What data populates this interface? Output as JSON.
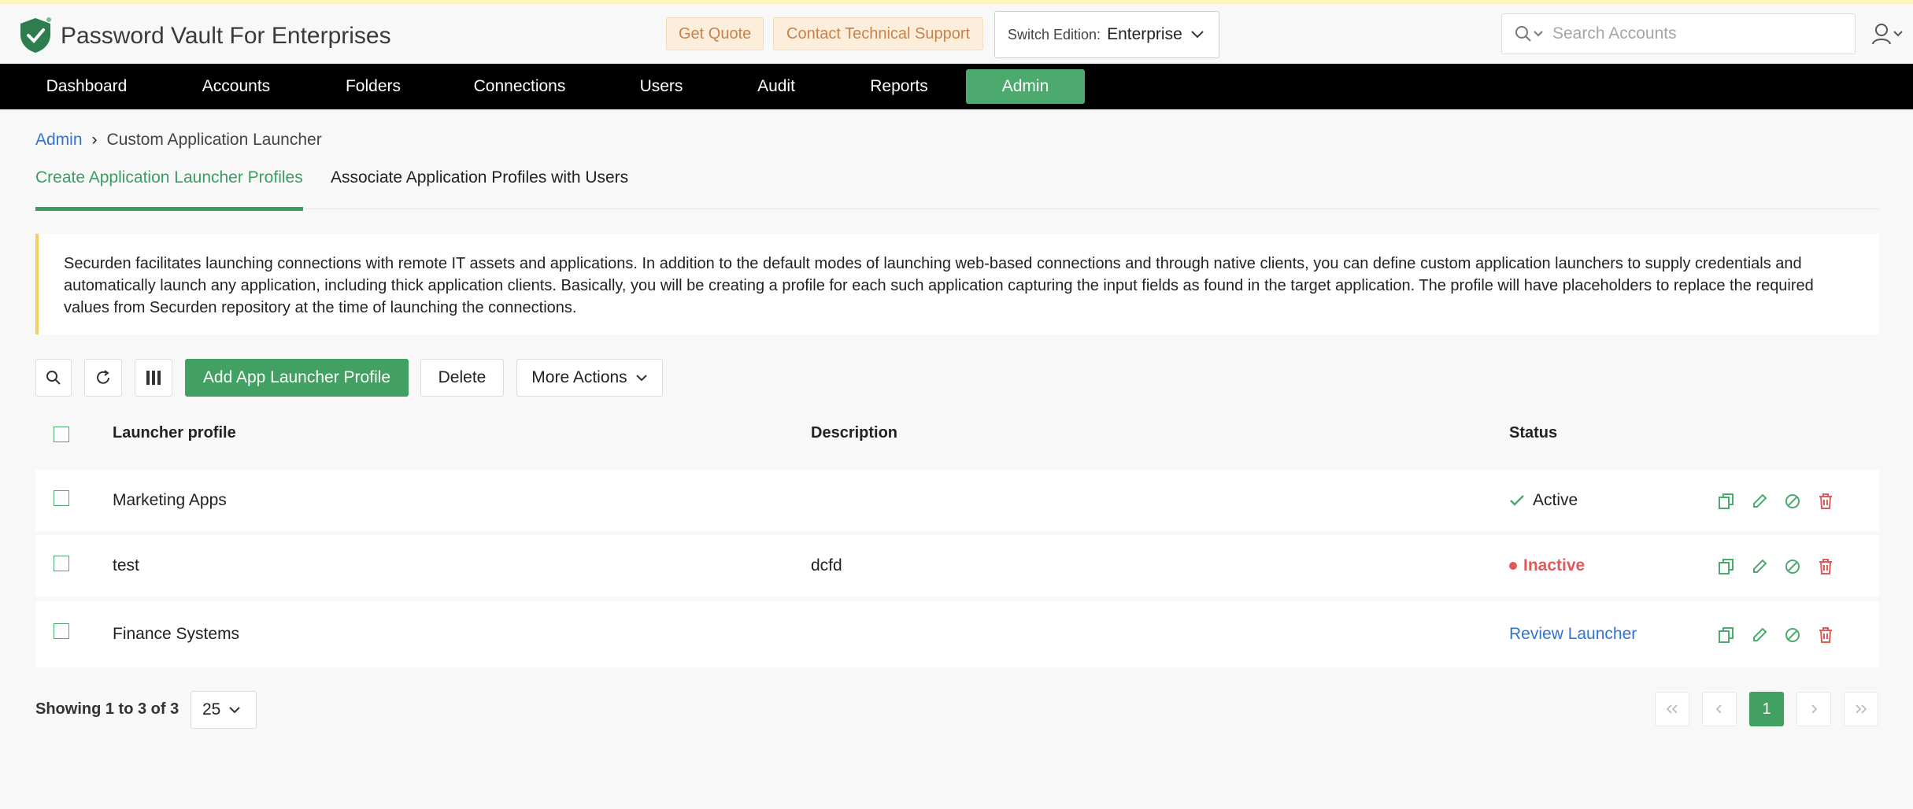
{
  "header": {
    "app_title": "Password Vault For Enterprises",
    "get_quote": "Get Quote",
    "contact_support": "Contact Technical Support",
    "edition_label": "Switch Edition:",
    "edition_value": "Enterprise",
    "search_placeholder": "Search Accounts"
  },
  "nav": {
    "items": [
      {
        "label": "Dashboard"
      },
      {
        "label": "Accounts"
      },
      {
        "label": "Folders"
      },
      {
        "label": "Connections"
      },
      {
        "label": "Users"
      },
      {
        "label": "Audit"
      },
      {
        "label": "Reports"
      },
      {
        "label": "Admin",
        "active": true
      }
    ]
  },
  "breadcrumb": {
    "root": "Admin",
    "separator": "›",
    "current": "Custom Application Launcher"
  },
  "tabs": [
    {
      "label": "Create Application Launcher Profiles",
      "active": true
    },
    {
      "label": "Associate Application Profiles with Users",
      "active": false
    }
  ],
  "notice": {
    "text": "Securden facilitates launching connections with remote IT assets and applications. In addition to the default modes of launching web-based connections and through native clients, you can define custom application launchers to supply credentials and automatically launch any application, including thick application clients. Basically, you will be creating a profile for each such application capturing the input fields as found in the target application. The profile will have placeholders to replace the required values from Securden repository at the time of launching the connections."
  },
  "toolbar": {
    "add_label": "Add App Launcher Profile",
    "delete_label": "Delete",
    "more_label": "More Actions"
  },
  "table": {
    "columns": [
      "Launcher profile",
      "Description",
      "Status"
    ],
    "rows": [
      {
        "name": "Marketing Apps",
        "description": "",
        "status": "Active",
        "status_type": "active"
      },
      {
        "name": "test",
        "description": "dcfd",
        "status": "Inactive",
        "status_type": "inactive"
      },
      {
        "name": "Finance Systems",
        "description": "",
        "status": "Review Launcher",
        "status_type": "link"
      }
    ]
  },
  "footer": {
    "showing": "Showing 1 to 3 of 3",
    "page_size": "25",
    "current_page": "1"
  },
  "colors": {
    "accent_green": "#41a062",
    "nav_bg": "#000000",
    "link_blue": "#2f74d0",
    "inactive_red": "#e05a5a",
    "notice_border": "#f2cf63"
  }
}
